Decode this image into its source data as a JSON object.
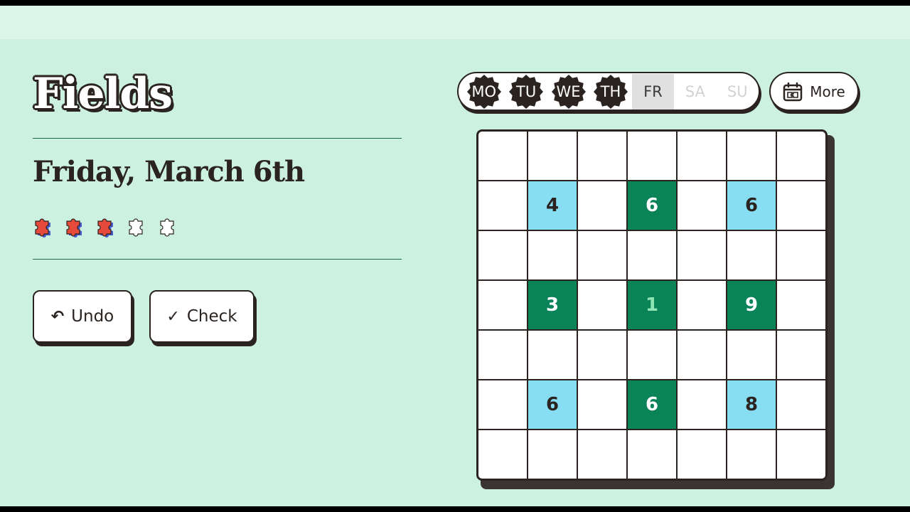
{
  "title": "Fields",
  "date": "Friday, March 6th",
  "progress": {
    "filled": 3,
    "total": 5,
    "filled_color": "#e64a3b",
    "empty_color": "#ffffff"
  },
  "buttons": {
    "undo_label": "Undo",
    "undo_icon": "undo-arrow-icon",
    "check_label": "Check",
    "check_icon": "checkmark-icon"
  },
  "days": [
    {
      "label": "MO",
      "state": "completed"
    },
    {
      "label": "TU",
      "state": "completed"
    },
    {
      "label": "WE",
      "state": "completed"
    },
    {
      "label": "TH",
      "state": "completed"
    },
    {
      "label": "FR",
      "state": "current"
    },
    {
      "label": "SA",
      "state": "future"
    },
    {
      "label": "SU",
      "state": "future"
    }
  ],
  "more": {
    "label": "More",
    "icon": "calendar-puzzle-icon"
  },
  "grid": {
    "size": 7,
    "clues": [
      {
        "row": 1,
        "col": 1,
        "value": "4",
        "color": "blue"
      },
      {
        "row": 1,
        "col": 3,
        "value": "6",
        "color": "green"
      },
      {
        "row": 1,
        "col": 5,
        "value": "6",
        "color": "blue"
      },
      {
        "row": 3,
        "col": 1,
        "value": "3",
        "color": "green"
      },
      {
        "row": 3,
        "col": 3,
        "value": "1",
        "color": "green",
        "complete": true
      },
      {
        "row": 3,
        "col": 5,
        "value": "9",
        "color": "green"
      },
      {
        "row": 5,
        "col": 1,
        "value": "6",
        "color": "blue"
      },
      {
        "row": 5,
        "col": 3,
        "value": "6",
        "color": "green"
      },
      {
        "row": 5,
        "col": 5,
        "value": "8",
        "color": "blue"
      }
    ]
  },
  "colors": {
    "background": "#cdf1e1",
    "blue": "#87def2",
    "green": "#0b8358",
    "ink": "#2a2320"
  }
}
